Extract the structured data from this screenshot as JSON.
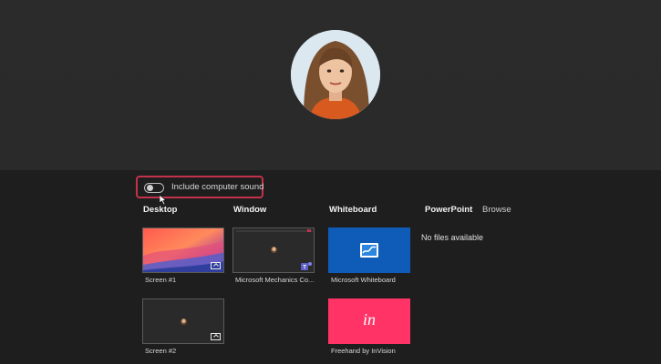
{
  "sound": {
    "label": "Include computer sound"
  },
  "sections": {
    "desktop": "Desktop",
    "window": "Window",
    "whiteboard": "Whiteboard",
    "powerpoint": "PowerPoint",
    "browse": "Browse"
  },
  "desktop": {
    "screen1": "Screen #1",
    "screen2": "Screen #2"
  },
  "window": {
    "item1": "Microsoft Mechanics Co..."
  },
  "whiteboard": {
    "item1": "Microsoft Whiteboard",
    "item2": "Freehand by InVision",
    "invision_logo": "in"
  },
  "powerpoint": {
    "empty": "No files available"
  },
  "colors": {
    "accent_red": "#c4314b",
    "whiteboard_blue": "#0f5cb8",
    "invision_pink": "#ff3366"
  }
}
